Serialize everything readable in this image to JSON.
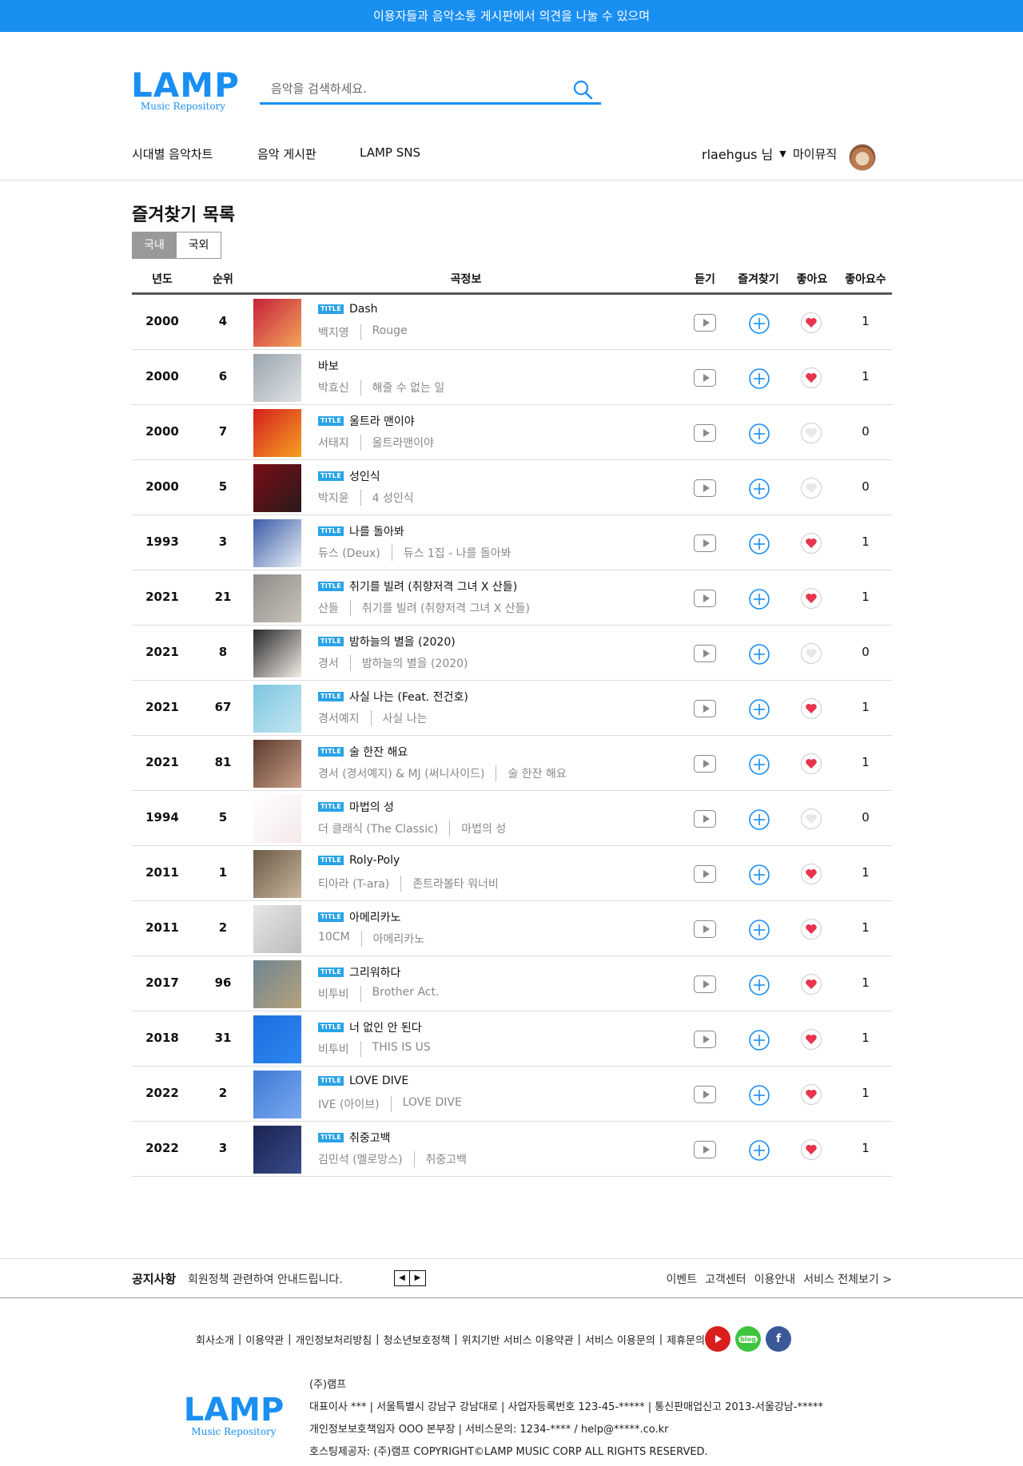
{
  "banner": "이용자들과 음악소통 게시판에서 의견을 나눌 수 있으며",
  "logo": {
    "main": "LAMP",
    "sub": "Music Repository"
  },
  "search": {
    "placeholder": "음악을 검색하세요."
  },
  "nav": {
    "items": [
      "시대별 음악차트",
      "음악 게시판",
      "LAMP SNS"
    ],
    "user": "rlaehgus 님",
    "mymusic": "마이뮤직"
  },
  "page_title": "즐겨찾기 목록",
  "tabs": [
    "국내",
    "국외"
  ],
  "table": {
    "headers": {
      "year": "년도",
      "rank": "순위",
      "info": "곡정보",
      "listen": "듣기",
      "favorite": "즐겨찾기",
      "like": "좋아요",
      "likes": "좋아요수"
    },
    "badge": "TITLE",
    "rows": [
      {
        "year": "2000",
        "rank": "4",
        "title": "Dash",
        "artist": "백지영",
        "album": "Rouge",
        "badge": true,
        "liked": true,
        "likes": "1",
        "cover": [
          "#c7213b",
          "#f2a45a"
        ]
      },
      {
        "year": "2000",
        "rank": "6",
        "title": "바보",
        "artist": "박효신",
        "album": "해줄 수 없는 일",
        "badge": false,
        "liked": true,
        "likes": "1",
        "cover": [
          "#9aa5ae",
          "#dfe3e6"
        ]
      },
      {
        "year": "2000",
        "rank": "7",
        "title": "울트라 맨이야",
        "artist": "서태지",
        "album": "울트라맨이야",
        "badge": true,
        "liked": false,
        "likes": "0",
        "cover": [
          "#d41f1f",
          "#f6a020"
        ]
      },
      {
        "year": "2000",
        "rank": "5",
        "title": "성인식",
        "artist": "박지윤",
        "album": "4 성인식",
        "badge": true,
        "liked": false,
        "likes": "0",
        "cover": [
          "#7a0d14",
          "#2a1a1c"
        ]
      },
      {
        "year": "1993",
        "rank": "3",
        "title": "나를 돌아봐",
        "artist": "듀스 (Deux)",
        "album": "듀스 1집 - 나를 돌아봐",
        "badge": true,
        "liked": true,
        "likes": "1",
        "cover": [
          "#3b5ca8",
          "#e8eef5"
        ]
      },
      {
        "year": "2021",
        "rank": "21",
        "title": "취기를 빌려 (취향저격 그녀 X 산들)",
        "artist": "산들",
        "album": "취기를 빌려 (취향저격 그녀 X 산들)",
        "badge": true,
        "liked": true,
        "likes": "1",
        "cover": [
          "#8d8a86",
          "#c9c3bb"
        ]
      },
      {
        "year": "2021",
        "rank": "8",
        "title": "밤하늘의 별을 (2020)",
        "artist": "경서",
        "album": "밤하늘의 별을 (2020)",
        "badge": true,
        "liked": false,
        "likes": "0",
        "cover": [
          "#2a2a2a",
          "#f2ede6"
        ]
      },
      {
        "year": "2021",
        "rank": "67",
        "title": "사실 나는 (Feat. 전건호)",
        "artist": "경서예지",
        "album": "사실 나는",
        "badge": true,
        "liked": true,
        "likes": "1",
        "cover": [
          "#7cc6e0",
          "#c4e6f2"
        ]
      },
      {
        "year": "2021",
        "rank": "81",
        "title": "술 한잔 해요",
        "artist": "경서 (경서예지) & MJ (써니사이드)",
        "album": "술 한잔 해요",
        "badge": true,
        "liked": true,
        "likes": "1",
        "cover": [
          "#5b3b2e",
          "#c99d86"
        ]
      },
      {
        "year": "1994",
        "rank": "5",
        "title": "마법의 성",
        "artist": "더 클래식 (The Classic)",
        "album": "마법의 성",
        "badge": true,
        "liked": false,
        "likes": "0",
        "cover": [
          "#ffffff",
          "#f4e9e9"
        ]
      },
      {
        "year": "2011",
        "rank": "1",
        "title": "Roly-Poly",
        "artist": "티아라 (T-ara)",
        "album": "존트라볼타 워너비",
        "badge": true,
        "liked": true,
        "likes": "1",
        "cover": [
          "#6b5a48",
          "#c8b59a"
        ]
      },
      {
        "year": "2011",
        "rank": "2",
        "title": "아메리카노",
        "artist": "10CM",
        "album": "아메리카노",
        "badge": true,
        "liked": true,
        "likes": "1",
        "cover": [
          "#e6e6e6",
          "#bcbcbc"
        ]
      },
      {
        "year": "2017",
        "rank": "96",
        "title": "그리워하다",
        "artist": "비투비",
        "album": "Brother Act.",
        "badge": true,
        "liked": true,
        "likes": "1",
        "cover": [
          "#6e8692",
          "#b6a27c"
        ]
      },
      {
        "year": "2018",
        "rank": "31",
        "title": "너 없인 안 된다",
        "artist": "비투비",
        "album": "THIS IS US",
        "badge": true,
        "liked": true,
        "likes": "1",
        "cover": [
          "#1f6fe0",
          "#2b86f0"
        ]
      },
      {
        "year": "2022",
        "rank": "2",
        "title": "LOVE DIVE",
        "artist": "IVE (아이브)",
        "album": "LOVE DIVE",
        "badge": true,
        "liked": true,
        "likes": "1",
        "cover": [
          "#3f7ad6",
          "#7aa8ee"
        ]
      },
      {
        "year": "2022",
        "rank": "3",
        "title": "취중고백",
        "artist": "김민석 (멜로망스)",
        "album": "취중고백",
        "badge": true,
        "liked": true,
        "likes": "1",
        "cover": [
          "#1b2452",
          "#3a4b8a"
        ]
      }
    ]
  },
  "notice": {
    "label": "공지사항",
    "text": "회원정책 관련하여 안내드립니다.",
    "links": [
      "이벤트",
      "고객센터",
      "이용안내",
      "서비스 전체보기 >"
    ]
  },
  "footer": {
    "links": [
      "회사소개",
      "이용약관",
      "개인정보처리방침",
      "청소년보호정책",
      "위치기반 서비스 이용약관",
      "서비스 이용문의",
      "제휴문의"
    ],
    "social": [
      {
        "name": "youtube",
        "color": "#d91e1e"
      },
      {
        "name": "blog",
        "label": "blog",
        "color": "#3ec43e"
      },
      {
        "name": "facebook",
        "label": "f",
        "color": "#3b5998"
      }
    ],
    "company": "(주)램프",
    "info1": "대표이사 *** | 서울특별시 강남구 강남대로 | 사업자등록번호 123-45-***** | 통신판매업신고 2013-서울강남-*****",
    "info2": "개인정보보호책임자 OOO 본부장 | 서비스문의: 1234-**** / help@*****.co.kr",
    "info3": "호스팅제공자: (주)램프 COPYRIGHT©LAMP MUSIC CORP ALL RIGHTS RESERVED."
  },
  "colors": {
    "accent": "#1a8ff2",
    "like": "#e8344e"
  }
}
